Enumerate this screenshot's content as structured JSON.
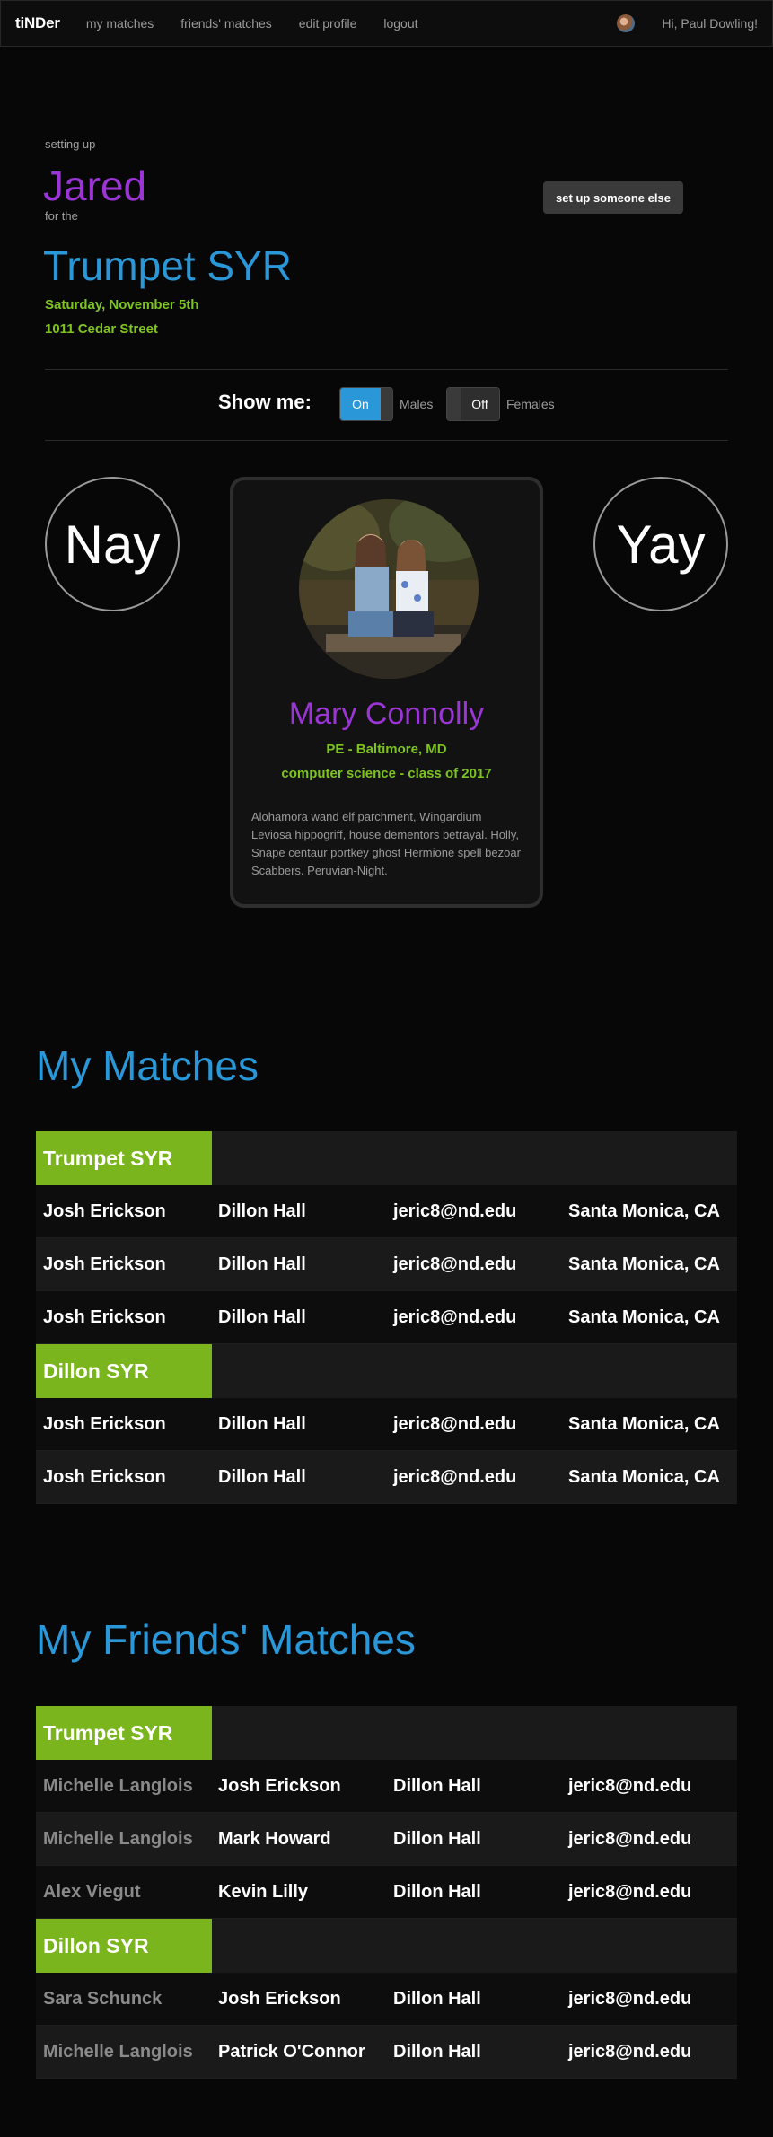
{
  "nav": {
    "brand": "tiNDer",
    "links": [
      "my matches",
      "friends' matches",
      "edit profile",
      "logout"
    ],
    "greeting": "Hi, Paul Dowling!"
  },
  "setup": {
    "intro": "setting up",
    "person": "Jared",
    "for_the": "for the",
    "event": "Trumpet SYR",
    "date": "Saturday, November 5th",
    "location": "1011 Cedar Street",
    "button": "set up someone else"
  },
  "filter": {
    "label": "Show me:",
    "males_toggle": "On",
    "males_label": "Males",
    "females_toggle": "Off",
    "females_label": "Females"
  },
  "vote": {
    "nay": "Nay",
    "yay": "Yay"
  },
  "card": {
    "name": "Mary Connolly",
    "location": "PE - Baltimore, MD",
    "major": "computer science - class of 2017",
    "bio": "Alohamora wand elf parchment, Wingardium Leviosa hippogriff, house dementors betrayal. Holly, Snape centaur portkey ghost Hermione spell bezoar Scabbers. Peruvian-Night."
  },
  "my_matches": {
    "title": "My Matches",
    "groups": [
      {
        "name": "Trumpet SYR",
        "rows": [
          [
            "Josh Erickson",
            "Dillon Hall",
            "jeric8@nd.edu",
            "Santa Monica, CA"
          ],
          [
            "Josh Erickson",
            "Dillon Hall",
            "jeric8@nd.edu",
            "Santa Monica, CA"
          ],
          [
            "Josh Erickson",
            "Dillon Hall",
            "jeric8@nd.edu",
            "Santa Monica, CA"
          ]
        ]
      },
      {
        "name": "Dillon SYR",
        "rows": [
          [
            "Josh Erickson",
            "Dillon Hall",
            "jeric8@nd.edu",
            "Santa Monica, CA"
          ],
          [
            "Josh Erickson",
            "Dillon Hall",
            "jeric8@nd.edu",
            "Santa Monica, CA"
          ]
        ]
      }
    ]
  },
  "friends_matches": {
    "title": "My Friends' Matches",
    "groups": [
      {
        "name": "Trumpet SYR",
        "rows": [
          [
            "Michelle Langlois",
            "Josh Erickson",
            "Dillon Hall",
            "jeric8@nd.edu"
          ],
          [
            "Michelle Langlois",
            "Mark Howard",
            "Dillon Hall",
            "jeric8@nd.edu"
          ],
          [
            "Alex Viegut",
            "Kevin Lilly",
            "Dillon Hall",
            "jeric8@nd.edu"
          ]
        ]
      },
      {
        "name": "Dillon SYR",
        "rows": [
          [
            "Sara Schunck",
            "Josh Erickson",
            "Dillon Hall",
            "jeric8@nd.edu"
          ],
          [
            "Michelle Langlois",
            "Patrick O'Connor",
            "Dillon Hall",
            "jeric8@nd.edu"
          ]
        ]
      }
    ]
  },
  "colors": {
    "purple": "#9b35d6",
    "blue": "#2a98d8",
    "green": "#7ec41e",
    "group_green": "#7ab51d"
  }
}
